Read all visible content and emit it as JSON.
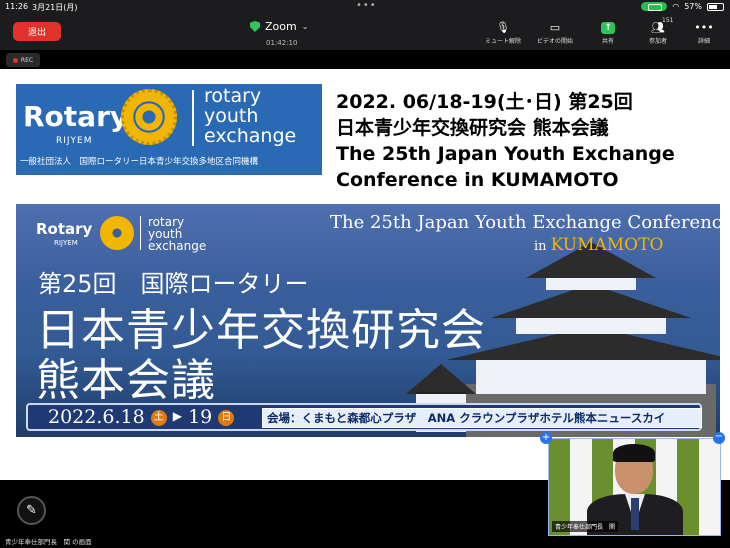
{
  "status_bar": {
    "time": "11:26",
    "date": "3月21日(月)",
    "dots": "•••",
    "battery_pct": "57%"
  },
  "toolbar": {
    "leave_label": "退出",
    "app_name": "Zoom",
    "elapsed": "01:42:10",
    "items": [
      {
        "label": "ミュート解除",
        "icon": "mic-off-icon"
      },
      {
        "label": "ビデオの開始",
        "icon": "video-off-icon"
      },
      {
        "label": "共有",
        "icon": "share-icon"
      },
      {
        "label": "参加者",
        "icon": "participants-icon",
        "count": "151"
      },
      {
        "label": "詳細",
        "icon": "more-icon"
      }
    ],
    "rec_label": "REC"
  },
  "slide": {
    "logo": {
      "brand": "Rotary",
      "sub": "RIJYEM",
      "program": [
        "rotary",
        "youth",
        "exchange"
      ],
      "org": "一般社団法人　国際ロータリー日本青少年交換多地区合同機構"
    },
    "heading": [
      "2022. 06/18-19(土･日) 第25回",
      "日本青少年交換研究会 熊本会議",
      "The 25th Japan Youth Exchange",
      "Conference in KUMAMOTO"
    ],
    "banner": {
      "brand": "Rotary",
      "sub": "RIJYEM",
      "program": [
        "rotary",
        "youth",
        "exchange"
      ],
      "en_title": "The  25th Japan Youth Exchange Conference",
      "en_in": "in ",
      "en_city": "KUMAMOTO",
      "line1": "第25回　国際ロータリー",
      "line2": "日本青少年交換研究会",
      "line3": "熊本会議",
      "date_start": "2022.6.18",
      "day1": "土",
      "date_end": "19",
      "day2": "日",
      "venue": "会場：くまもと森都心プラザ　ANA クラウンプラザホテル熊本ニュースカイ"
    }
  },
  "bottom": {
    "share_label": "青少年奉仕部門長　関 の画面"
  },
  "video": {
    "name": "青少年奉仕部門長　関"
  }
}
